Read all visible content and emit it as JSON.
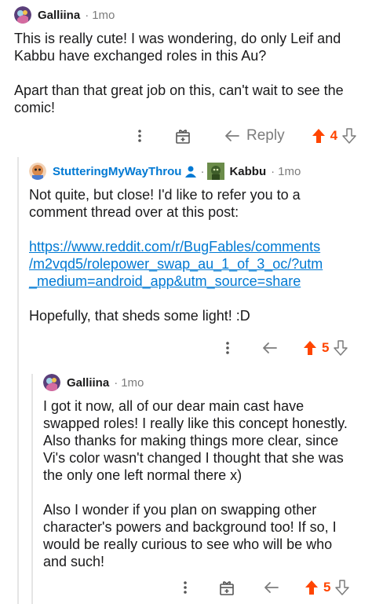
{
  "comment1": {
    "username": "Galliina",
    "time": "1mo",
    "paragraphs": [
      "This is really cute! I was wondering, do only Leif and Kabbu have exchanged roles in this Au?",
      "Apart than that great job on this, can't wait to see the comic!"
    ],
    "reply_label": "Reply",
    "votes": "4"
  },
  "comment2": {
    "username": "StutteringMyWayThrou",
    "flair": "Kabbu",
    "time": "1mo",
    "text_before": "Not quite, but close! I'd like to refer you to a comment thread over at this post:",
    "link_lines": [
      "https://www.reddit.com/r/BugFables/comments",
      "/m2vqd5/rolepower_swap_au_1_of_3_oc/?utm",
      "_medium=android_app&utm_source=share"
    ],
    "text_after": "Hopefully, that sheds some light! :D",
    "votes": "5"
  },
  "comment3": {
    "username": "Galliina",
    "time": "1mo",
    "paragraphs": [
      "I got it now, all of our dear main cast have swapped roles! I really like this concept honestly. Also thanks for making things more clear, since Vi's color wasn't changed I thought that she was the only one left normal there x)",
      "Also I wonder if you plan on swapping other character's powers and background too! If so, I would be really curious to see who will be who and such!"
    ],
    "votes": "5"
  },
  "colors": {
    "upvote": "#ff4500",
    "link": "#0079d3",
    "meta": "#7c7c7c"
  },
  "icons": [
    "more-vertical-icon",
    "award-icon",
    "reply-arrow-icon",
    "upvote-arrow-icon",
    "downvote-arrow-icon",
    "person-icon"
  ]
}
